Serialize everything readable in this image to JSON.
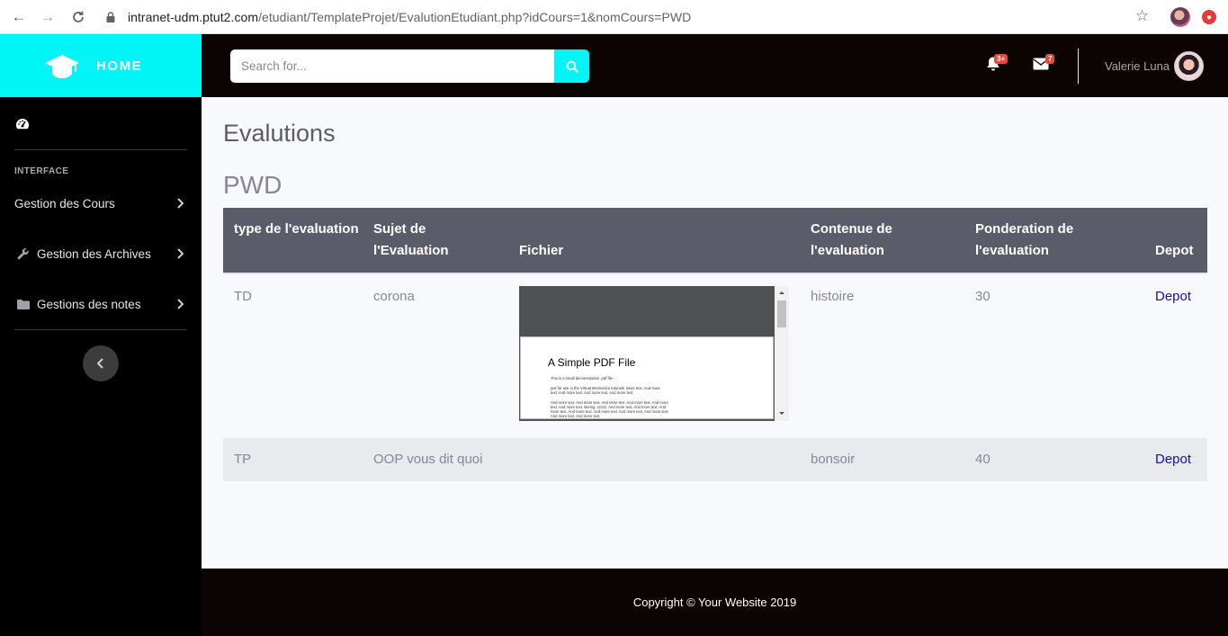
{
  "browser": {
    "url_host": "intranet-udm.ptut2.com",
    "url_path": "/etudiant/TemplateProjet/EvalutionEtudiant.php?idCours=1&nomCours=PWD"
  },
  "sidebar": {
    "brand": "HOME",
    "heading": "INTERFACE",
    "items": [
      {
        "label": "Gestion des Cours",
        "icon": "none"
      },
      {
        "label": "Gestion des Archives",
        "icon": "wrench-icon"
      },
      {
        "label": "Gestions des notes",
        "icon": "folder-icon"
      }
    ]
  },
  "topbar": {
    "search_placeholder": "Search for...",
    "alerts_badge": "3+",
    "messages_badge": "7",
    "user_name": "Valerie Luna"
  },
  "main": {
    "title": "Evalutions",
    "course": "PWD",
    "columns": [
      "type de l'evaluation",
      "Sujet de l'Evaluation",
      "Fichier",
      "Contenue de l'evaluation",
      "Ponderation de l'evaluation",
      "Depot"
    ],
    "rows": [
      {
        "type": "TD",
        "sujet": "corona",
        "contenu": "histoire",
        "ponderation": "30",
        "depot": "Depot"
      },
      {
        "type": "TP",
        "sujet": "OOP vous dit quoi",
        "contenu": "bonsoir",
        "ponderation": "40",
        "depot": "Depot"
      }
    ],
    "pdf": {
      "title": "A Simple PDF File",
      "lines": [
        "This is a small demonstration .pdf file -",
        "just for use in the Virtual Mechanics tutorials. More text. And more",
        "text. And more text. And more text. And more text.",
        "And more text. And more text. And more text. And more text. And more",
        "text. And more text. Boring, zzzzz. And more text. And more text. And",
        "more text. And more text. And more text. And more text. And more text.",
        "And more text. And more text."
      ]
    }
  },
  "footer": {
    "copyright": "Copyright © Your Website 2019"
  },
  "colors": {
    "accent": "#00f5f7",
    "topbar": "#0c0303",
    "sidebar": "#000000",
    "table_header": "#5a5c69",
    "link": "#1a0dab"
  }
}
